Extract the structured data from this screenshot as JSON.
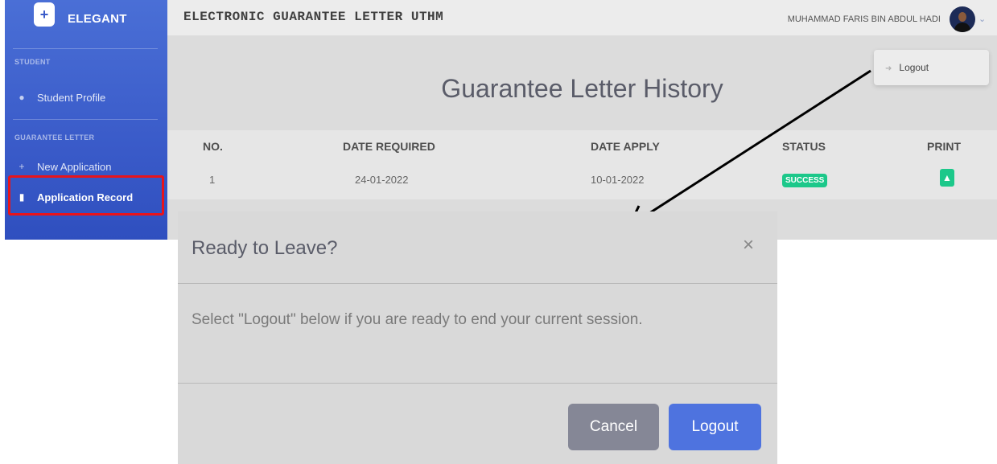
{
  "sidebar": {
    "brand": "ELEGANT",
    "sections": [
      {
        "heading": "STUDENT",
        "items": [
          {
            "label": "Student Profile",
            "icon": "user-icon"
          }
        ]
      },
      {
        "heading": "GUARANTEE LETTER",
        "items": [
          {
            "label": "New Application",
            "icon": "plus-icon"
          },
          {
            "label": "Application Record",
            "icon": "file-icon",
            "active": true
          }
        ]
      }
    ]
  },
  "topbar": {
    "title": "ELECTRONIC GUARANTEE LETTER UTHM",
    "user_name": "MUHAMMAD FARIS BIN ABDUL HADI"
  },
  "dropdown": {
    "logout_label": "Logout"
  },
  "main": {
    "page_title": "Guarantee Letter History",
    "table": {
      "headers": [
        "NO.",
        "DATE REQUIRED",
        "DATE APPLY",
        "STATUS",
        "PRINT"
      ],
      "rows": [
        {
          "no": "1",
          "date_required": "24-01-2022",
          "date_apply": "10-01-2022",
          "status": "SUCCESS"
        }
      ]
    }
  },
  "modal": {
    "title": "Ready to Leave?",
    "close": "×",
    "body": "Select \"Logout\" below if you are ready to end your current session.",
    "cancel_label": "Cancel",
    "logout_label": "Logout"
  },
  "colors": {
    "sidebar": "#3a5bc9",
    "success": "#1cc88a",
    "primary": "#4e73df",
    "secondary": "#858796",
    "highlight": "#e8141b"
  }
}
